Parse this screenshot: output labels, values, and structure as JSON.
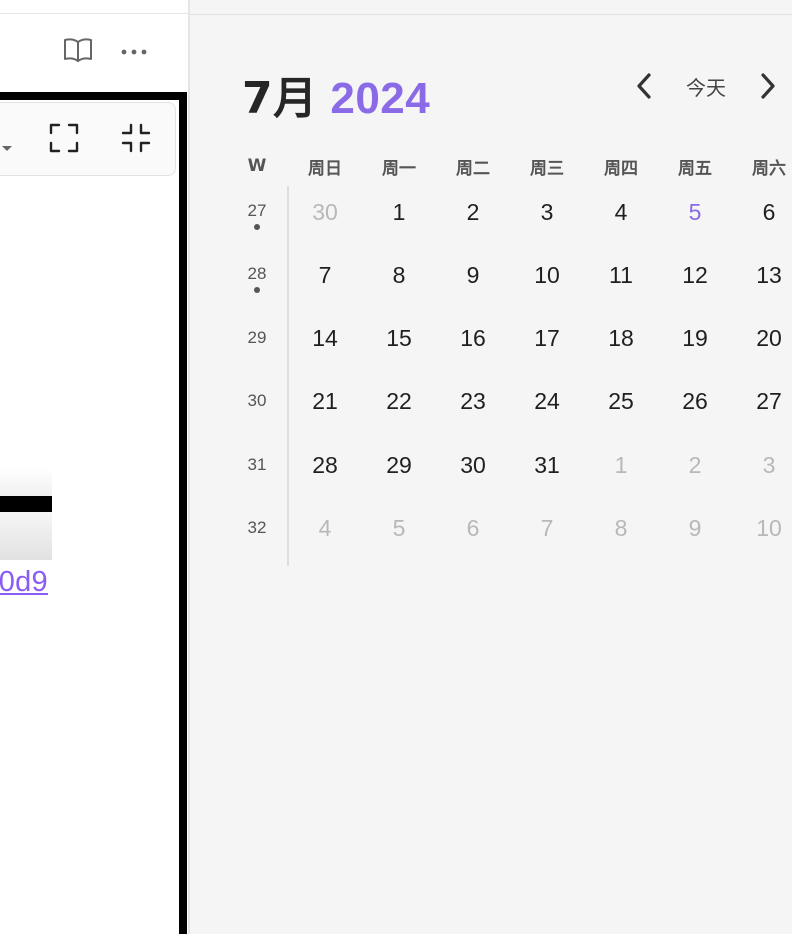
{
  "calendar": {
    "month": "7月",
    "year": "2024",
    "today_label": "今天",
    "week_header": "W",
    "weekdays": [
      "周日",
      "周一",
      "周二",
      "周三",
      "周四",
      "周五",
      "周六"
    ],
    "weeks": [
      {
        "number": "27",
        "has_dot": true,
        "days": [
          {
            "d": "30",
            "s": "muted"
          },
          {
            "d": "1"
          },
          {
            "d": "2"
          },
          {
            "d": "3"
          },
          {
            "d": "4"
          },
          {
            "d": "5",
            "s": "accent"
          },
          {
            "d": "6"
          }
        ]
      },
      {
        "number": "28",
        "has_dot": true,
        "days": [
          {
            "d": "7"
          },
          {
            "d": "8"
          },
          {
            "d": "9"
          },
          {
            "d": "10"
          },
          {
            "d": "11"
          },
          {
            "d": "12"
          },
          {
            "d": "13"
          }
        ]
      },
      {
        "number": "29",
        "has_dot": false,
        "days": [
          {
            "d": "14"
          },
          {
            "d": "15"
          },
          {
            "d": "16"
          },
          {
            "d": "17"
          },
          {
            "d": "18"
          },
          {
            "d": "19"
          },
          {
            "d": "20"
          }
        ]
      },
      {
        "number": "30",
        "has_dot": false,
        "days": [
          {
            "d": "21"
          },
          {
            "d": "22"
          },
          {
            "d": "23"
          },
          {
            "d": "24"
          },
          {
            "d": "25"
          },
          {
            "d": "26"
          },
          {
            "d": "27"
          }
        ]
      },
      {
        "number": "31",
        "has_dot": false,
        "days": [
          {
            "d": "28"
          },
          {
            "d": "29"
          },
          {
            "d": "30"
          },
          {
            "d": "31"
          },
          {
            "d": "1",
            "s": "muted"
          },
          {
            "d": "2",
            "s": "muted"
          },
          {
            "d": "3",
            "s": "muted"
          }
        ]
      },
      {
        "number": "32",
        "has_dot": false,
        "days": [
          {
            "d": "4",
            "s": "muted"
          },
          {
            "d": "5",
            "s": "muted"
          },
          {
            "d": "6",
            "s": "muted"
          },
          {
            "d": "7",
            "s": "muted"
          },
          {
            "d": "8",
            "s": "muted"
          },
          {
            "d": "9",
            "s": "muted"
          },
          {
            "d": "10",
            "s": "muted"
          }
        ]
      }
    ]
  },
  "left_pane": {
    "link_text": "0d9",
    "icons": {
      "reading_view": "book-open-icon",
      "more": "more-horizontal-icon",
      "fullscreen": "fullscreen-icon",
      "exit_fullscreen": "exit-fullscreen-icon",
      "dropdown": "chevron-down-icon"
    }
  },
  "colors": {
    "accent": "#8a6ae6",
    "link": "#8a5cf5",
    "muted_text": "#b8b8b8",
    "calendar_background": "#f5f5f5"
  }
}
